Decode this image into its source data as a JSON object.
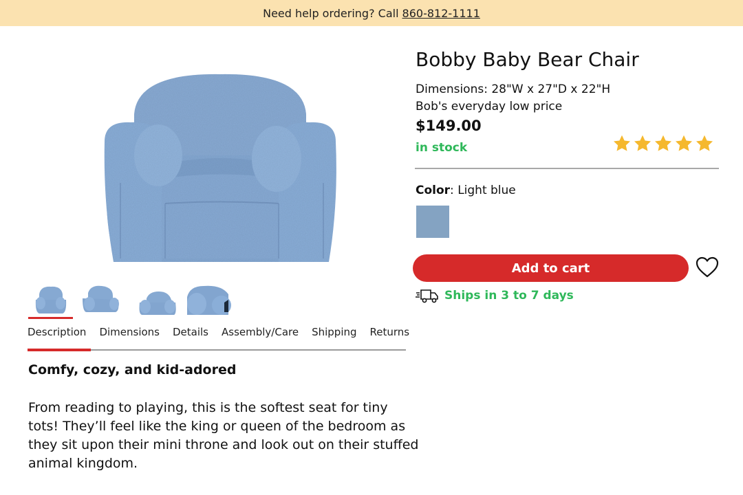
{
  "topbar": {
    "help_text": "Need help ordering? Call",
    "phone": "860-812-1111"
  },
  "product": {
    "title": "Bobby Baby Bear Chair",
    "dimensions": "Dimensions: 28\"W x 27\"D x 22\"H",
    "price_note": "Bob's everyday low price",
    "price": "$149.00",
    "stock_status": "in stock",
    "rating": 5,
    "rating_max": 5,
    "star_color": "#f5b82e",
    "color_label": "Color",
    "color_value": "Light blue",
    "swatch_color": "#84a3c2",
    "add_to_cart_label": "Add to cart",
    "shipping_text": "Ships in 3 to 7 days",
    "accent_color": "#d62a2a",
    "success_color": "#2fb85a"
  },
  "gallery": {
    "main_image": "light-blue-sherpa-kids-armchair",
    "thumbnails": [
      "chair-front-view",
      "chair-angle-view",
      "chair-side-view",
      "chair-closeup-view"
    ],
    "active_thumbnail": 0
  },
  "tabs": [
    {
      "label": "Description"
    },
    {
      "label": "Dimensions"
    },
    {
      "label": "Details"
    },
    {
      "label": "Assembly/Care"
    },
    {
      "label": "Shipping"
    },
    {
      "label": "Returns"
    }
  ],
  "description": {
    "heading": "Comfy, cozy, and kid-adored",
    "body": "From reading to playing, this is the softest seat for tiny tots! They’ll feel like the king or queen of the bedroom as they sit upon their mini throne and look out on their stuffed animal kingdom."
  }
}
